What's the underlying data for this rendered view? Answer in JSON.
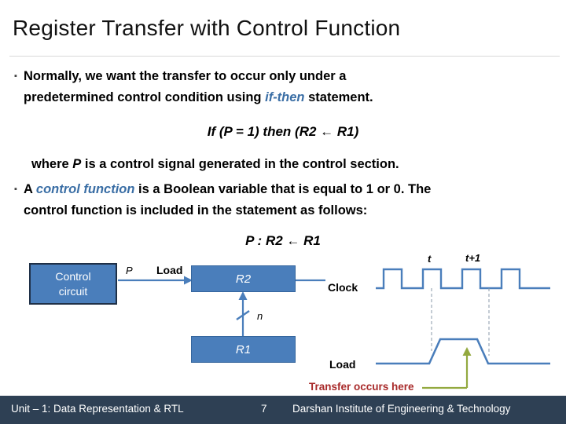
{
  "slide": {
    "title": "Register Transfer with Control Function"
  },
  "body": {
    "bullet_marker": "▪",
    "bullet1": {
      "line1": "Normally, we want the transfer to occur only under a",
      "line2_before": "predetermined control condition using ",
      "line2_emphasis": "if-then",
      "line2_after": " statement."
    },
    "equation1": "If (P = 1) then (R2 ← R1)",
    "where_before": "where ",
    "where_var": "P",
    "where_after": " is a control signal generated in the control section.",
    "bullet2": {
      "line1_before": "A ",
      "line1_emphasis": "control function",
      "line1_after": " is a Boolean variable that is equal to 1 or 0. The",
      "line2": "control function is included in the statement as follows:"
    },
    "equation2": "P : R2 ← R1"
  },
  "figure": {
    "control_box": {
      "line1": "Control",
      "line2": "circuit"
    },
    "r2_box": "R2",
    "r1_box": "R1",
    "label_p": "P",
    "label_load_block": "Load",
    "label_n": "n",
    "label_clock": "Clock",
    "label_t": "t",
    "label_t_plus_1": "t+1",
    "label_load_wave": "Load",
    "label_transfer": "Transfer occurs here"
  },
  "footer": {
    "unit": "Unit – 1: Data Representation & RTL",
    "page": "7",
    "institute": "Darshan Institute of Engineering & Technology"
  },
  "colors": {
    "block_fill": "#4a7ebb",
    "block_border": "#35659d",
    "control_border": "#1f3047",
    "wave_line": "#4a7ebb",
    "emphasis_blue": "#3a6ea5",
    "transfer_red": "#a82a2a",
    "arrow_green": "#93a93f",
    "footer_bg": "#2e4054",
    "divider": "#d9d9d9"
  }
}
